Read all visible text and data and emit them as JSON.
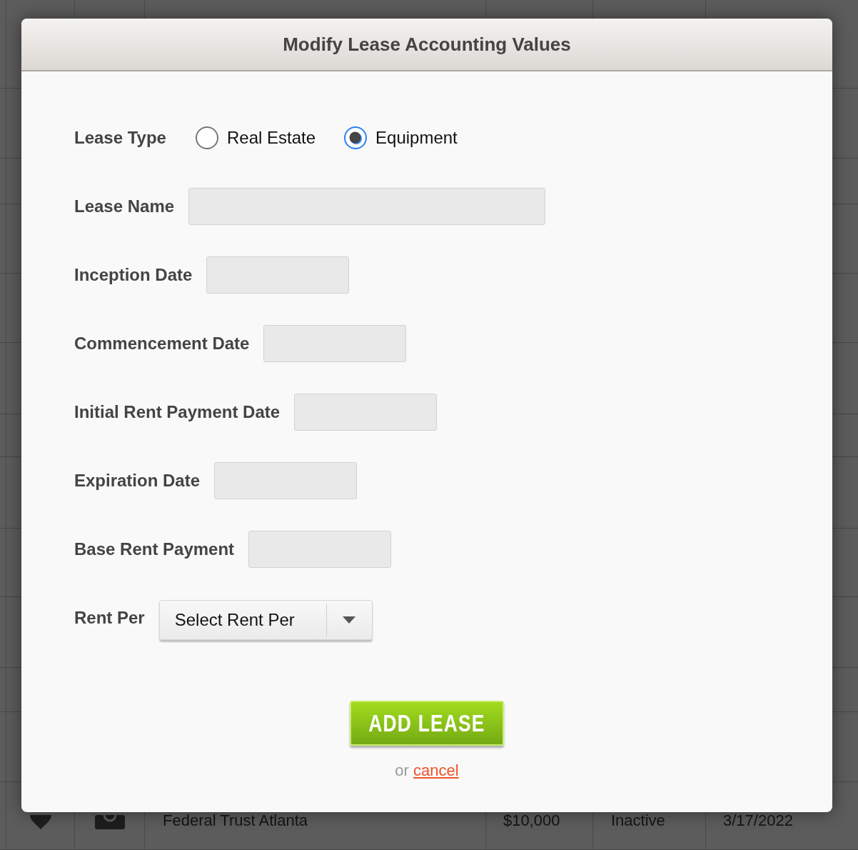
{
  "background_table": {
    "rows": [
      {
        "column_3": "Federal Trust Atlanta",
        "column_4": "$10,000",
        "column_5": "Inactive",
        "column_6": "3/17/2022"
      }
    ]
  },
  "dialog": {
    "title": "Modify Lease Accounting Values",
    "lease_type": {
      "label": "Lease Type",
      "options": [
        {
          "label": "Real Estate",
          "selected": false
        },
        {
          "label": "Equipment",
          "selected": true
        }
      ]
    },
    "fields": [
      {
        "kind": "text",
        "label": "Lease Name"
      },
      {
        "kind": "date",
        "label": "Inception Date"
      },
      {
        "kind": "date",
        "label": "Commencement Date"
      },
      {
        "kind": "date",
        "label": "Initial Rent Payment Date"
      },
      {
        "kind": "date",
        "label": "Expiration Date"
      },
      {
        "kind": "number",
        "label": "Base Rent Payment"
      },
      {
        "kind": "select",
        "label": "Rent Per",
        "placeholder": "Select Rent Per"
      }
    ],
    "submit_button": "ADD LEASE",
    "cancel": {
      "prefix": "or",
      "link": "cancel"
    }
  }
}
